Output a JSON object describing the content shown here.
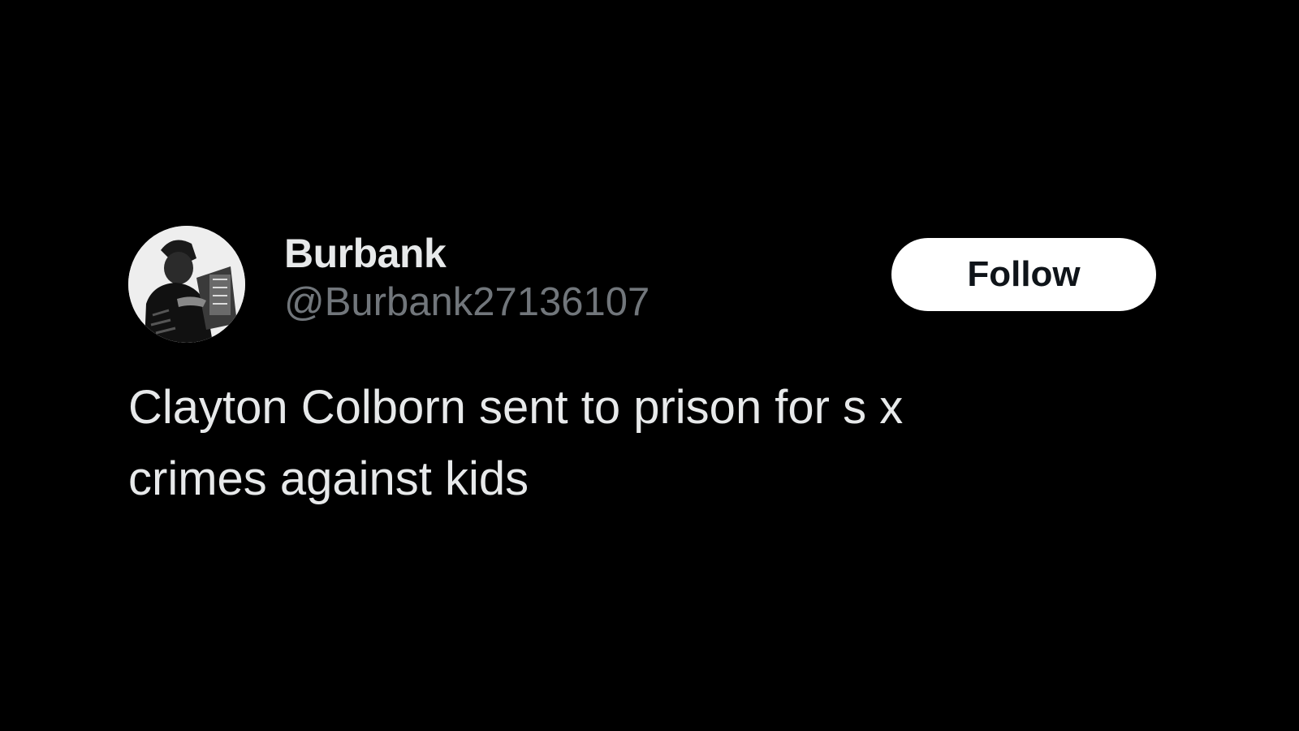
{
  "tweet": {
    "author": {
      "display_name": "Burbank",
      "handle": "@Burbank27136107",
      "avatar_icon": "vintage-illustration-avatar"
    },
    "follow_label": "Follow",
    "text_line1": "Clayton Colborn sent to prison for s x",
    "text_line2": "crimes against kids"
  },
  "colors": {
    "background": "#000000",
    "primary_text": "#e7e9ea",
    "secondary_text": "#71767b",
    "button_bg": "#ffffff",
    "button_text": "#0f1419"
  }
}
